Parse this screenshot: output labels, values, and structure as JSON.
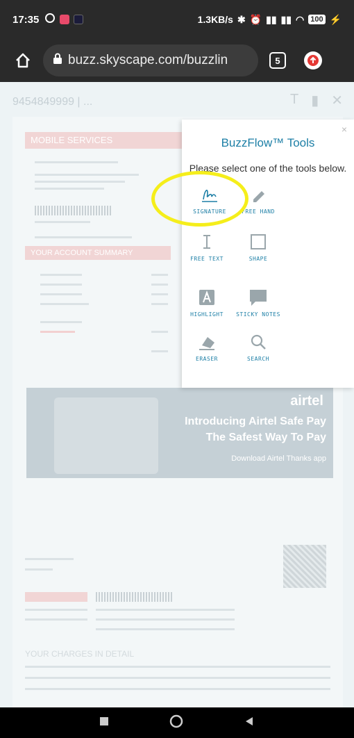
{
  "status_bar": {
    "time": "17:35",
    "speed": "1.3KB/s",
    "battery": "100"
  },
  "browser": {
    "url": "buzz.skyscape.com/buzzlin",
    "tab_count": "5"
  },
  "page": {
    "phone_line": "9454849999 | ..."
  },
  "tools_panel": {
    "title": "BuzzFlow™ Tools",
    "description": "Please select one of the tools below.",
    "close_label": "×",
    "tools": [
      {
        "label": "SIGNATURE",
        "icon": "signature-icon"
      },
      {
        "label": "FREE HAND",
        "icon": "pen-icon"
      },
      {
        "label": "FREE TEXT",
        "icon": "text-cursor-icon"
      },
      {
        "label": "SHAPE",
        "icon": "square-icon"
      },
      {
        "label": "HIGHLIGHT",
        "icon": "highlight-icon"
      },
      {
        "label": "STICKY NOTES",
        "icon": "speech-bubble-icon"
      },
      {
        "label": "ERASER",
        "icon": "eraser-icon"
      },
      {
        "label": "SEARCH",
        "icon": "search-icon"
      }
    ]
  },
  "promo": {
    "brand": "airtel",
    "line1": "Introducing Airtel Safe Pay",
    "line2": "The Safest Way To Pay",
    "line3": "Download Airtel Thanks app"
  },
  "doc": {
    "mobile_services": "MOBILE SERVICES",
    "account_summary": "YOUR ACCOUNT SUMMARY",
    "charges": "YOUR CHARGES IN DETAIL"
  },
  "colors": {
    "accent": "#1d7fa6",
    "annotation": "#f5ee1b"
  }
}
